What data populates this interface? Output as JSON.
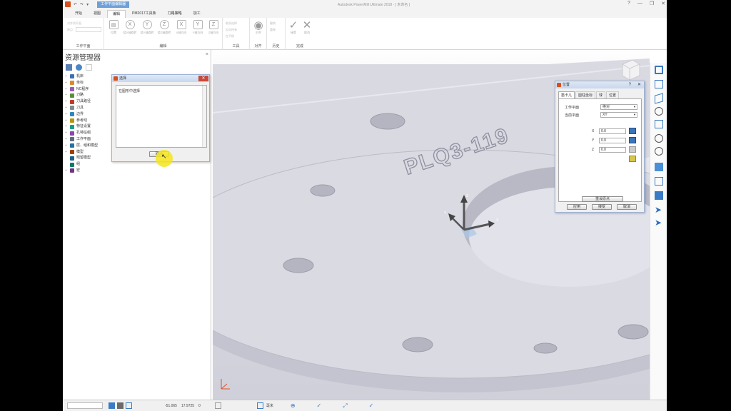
{
  "window": {
    "title": "Autodesk PowerMill Ultimate 2018   - [ 未命名 ]",
    "context_tab": "工作平面编辑器",
    "qat": [
      "↶",
      "↷",
      "▾"
    ],
    "controls": {
      "help": "?",
      "minimize": "—",
      "restore": "❐",
      "close": "✕"
    }
  },
  "tabs": [
    "开始",
    "视图",
    "编辑",
    "PM2017工具条",
    "刀路策略",
    "加工"
  ],
  "active_tab": 2,
  "ribbon": {
    "groups": [
      {
        "label": "工作平面",
        "lines": [
          "对齐到平面",
          "原点"
        ]
      },
      {
        "label": "编辑",
        "buttons": [
          "位置",
          "绕X轴旋转",
          "绕Y轴旋转",
          "绕Z轴旋转",
          "X轴方向",
          "Y轴方向",
          "Z轴方向"
        ]
      },
      {
        "label": "工具",
        "lines": [
          "取消选择",
          "反向所有",
          "在平移"
        ]
      },
      {
        "label": "对齐",
        "buttons": [
          "对齐"
        ]
      },
      {
        "label": "历史",
        "lines": [
          "撤销",
          "重做"
        ]
      },
      {
        "label": "完成",
        "buttons": [
          "接受",
          "取消"
        ]
      }
    ]
  },
  "explorer": {
    "title": "资源管理器",
    "close": "×",
    "tree": [
      {
        "label": "机床",
        "exp": "+"
      },
      {
        "label": "坐标",
        "exp": "+"
      },
      {
        "label": "NC程序",
        "exp": "+"
      },
      {
        "label": "刀路",
        "exp": "+"
      },
      {
        "label": "刀具路径",
        "exp": "+"
      },
      {
        "label": "刀具",
        "exp": "+"
      },
      {
        "label": "边界",
        "exp": "+"
      },
      {
        "label": "参考线",
        "exp": "+"
      },
      {
        "label": "特征设置",
        "exp": "+"
      },
      {
        "label": "孔特征组",
        "exp": "+"
      },
      {
        "label": "工作平面",
        "exp": "+"
      },
      {
        "label": "层、组和模型",
        "exp": "+"
      },
      {
        "label": "模型",
        "exp": "+"
      },
      {
        "label": "残留模型",
        "exp": ""
      },
      {
        "label": "组",
        "exp": ""
      },
      {
        "label": "宏",
        "exp": "+"
      }
    ]
  },
  "select_dialog": {
    "title": "选择",
    "text": "在图形中选择",
    "button": "取消"
  },
  "position_dialog": {
    "title": "位置",
    "tabs": [
      "笛卡儿",
      "圆柱坐标",
      "球",
      "位置"
    ],
    "workplane_label": "工作平面",
    "workplane_value": "绝对",
    "plane_label": "当前平面",
    "plane_value": "XY",
    "coords": [
      {
        "label": "X",
        "value": "0.0"
      },
      {
        "label": "Y",
        "value": "0.0"
      },
      {
        "label": "Z",
        "value": "0.0"
      }
    ],
    "reset_button": "重设原点",
    "buttons": [
      "应用",
      "接受",
      "取消"
    ]
  },
  "model": {
    "engraved_text": "PLQ3-119"
  },
  "statusbar": {
    "coord_x": "-51.065",
    "coord_y": "17.9725",
    "coord_z": "0",
    "unit": "毫米"
  },
  "colors": {
    "accent": "#6fa0d8",
    "app_logo": "#d64f1c",
    "highlight": "#f6e51c"
  }
}
